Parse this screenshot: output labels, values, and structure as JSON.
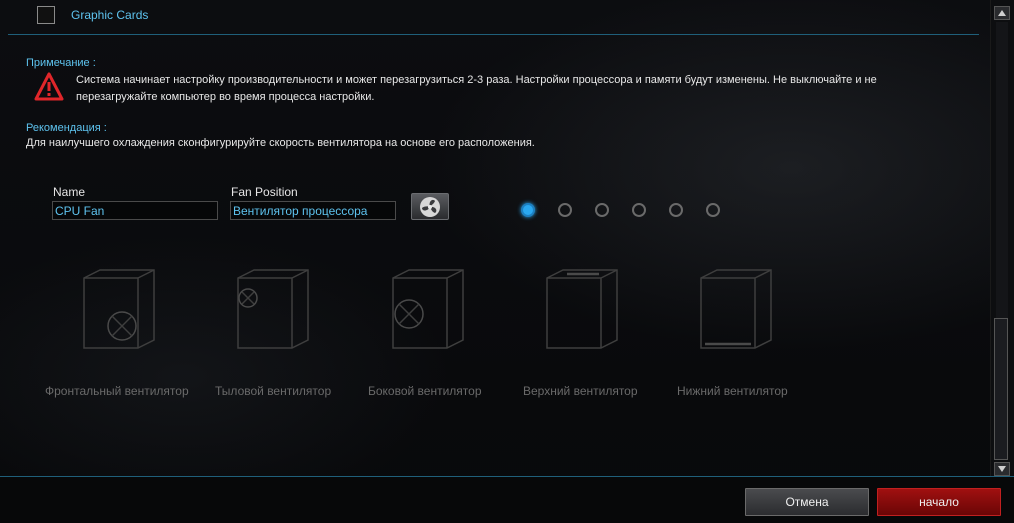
{
  "graphic_cards": {
    "label": "Graphic Cards",
    "checked": false
  },
  "note": {
    "title": "Примечание :",
    "line1": "Система начинает настройку производительности и может перезагрузиться 2-3 раза. Настройки процессора и памяти будут изменены. Не выключайте и не",
    "line2": "перезагружайте компьютер во время процесса настройки."
  },
  "recommendation": {
    "title": "Рекомендация :",
    "text": "Для наилучшего охлаждения сконфигурируйте скорость вентилятора на основе его расположения."
  },
  "form": {
    "name_label": "Name",
    "name_value": "CPU Fan",
    "position_label": "Fan Position",
    "position_value": "Вентилятор процессора"
  },
  "pager": {
    "count": 6,
    "active": 1
  },
  "fan_positions": [
    {
      "label": "Фронтальный вентилятор",
      "icon": "front-fan-case-icon"
    },
    {
      "label": "Тыловой вентилятор",
      "icon": "rear-fan-case-icon"
    },
    {
      "label": "Боковой вентилятор",
      "icon": "side-fan-case-icon"
    },
    {
      "label": "Верхний вентилятор",
      "icon": "top-fan-case-icon"
    },
    {
      "label": "Нижний вентилятор",
      "icon": "bottom-fan-case-icon"
    }
  ],
  "buttons": {
    "cancel": "Отмена",
    "start": "начало"
  },
  "colors": {
    "accent": "#5ec3ef",
    "start_button": "#8a0a0a",
    "active_dot": "#2aa8f0"
  }
}
